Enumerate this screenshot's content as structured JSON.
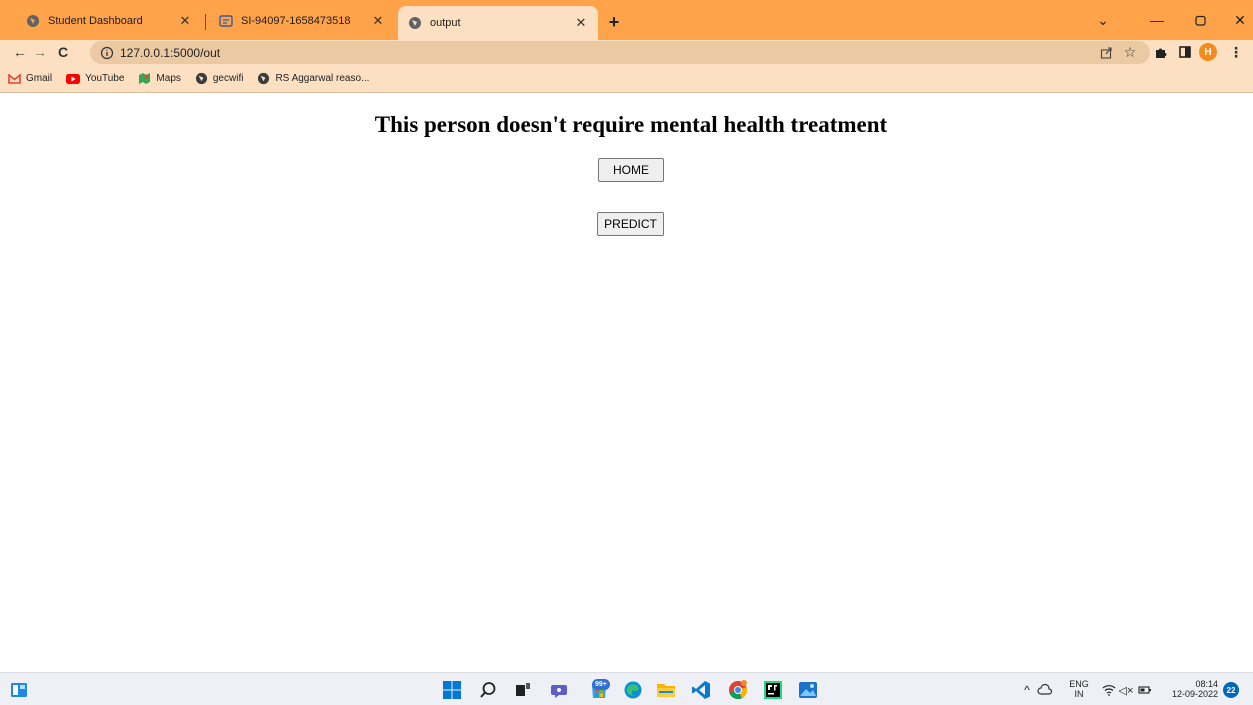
{
  "browser": {
    "tabs": [
      {
        "title": "Student Dashboard",
        "active": false
      },
      {
        "title": "SI-94097-1658473518",
        "active": false
      },
      {
        "title": "output",
        "active": true
      }
    ],
    "new_tab_label": "+",
    "url": "127.0.0.1:5000/out",
    "bookmarks": [
      {
        "label": "Gmail",
        "icon": "gmail-icon"
      },
      {
        "label": "YouTube",
        "icon": "youtube-icon"
      },
      {
        "label": "Maps",
        "icon": "maps-icon"
      },
      {
        "label": "gecwifi",
        "icon": "globe-icon"
      },
      {
        "label": "RS Aggarwal reaso...",
        "icon": "globe-icon"
      }
    ],
    "profile_initial": "H",
    "accent_color": "#ffa34a",
    "toolbar_color": "#fde0c2"
  },
  "page": {
    "heading": "This person doesn't require mental health treatment",
    "home_button": "HOME",
    "predict_button": "PREDICT"
  },
  "taskbar": {
    "store_badge": "99+",
    "language": "ENG",
    "region": "IN",
    "time": "08:14",
    "date": "12-09-2022",
    "notification_count": "22"
  }
}
